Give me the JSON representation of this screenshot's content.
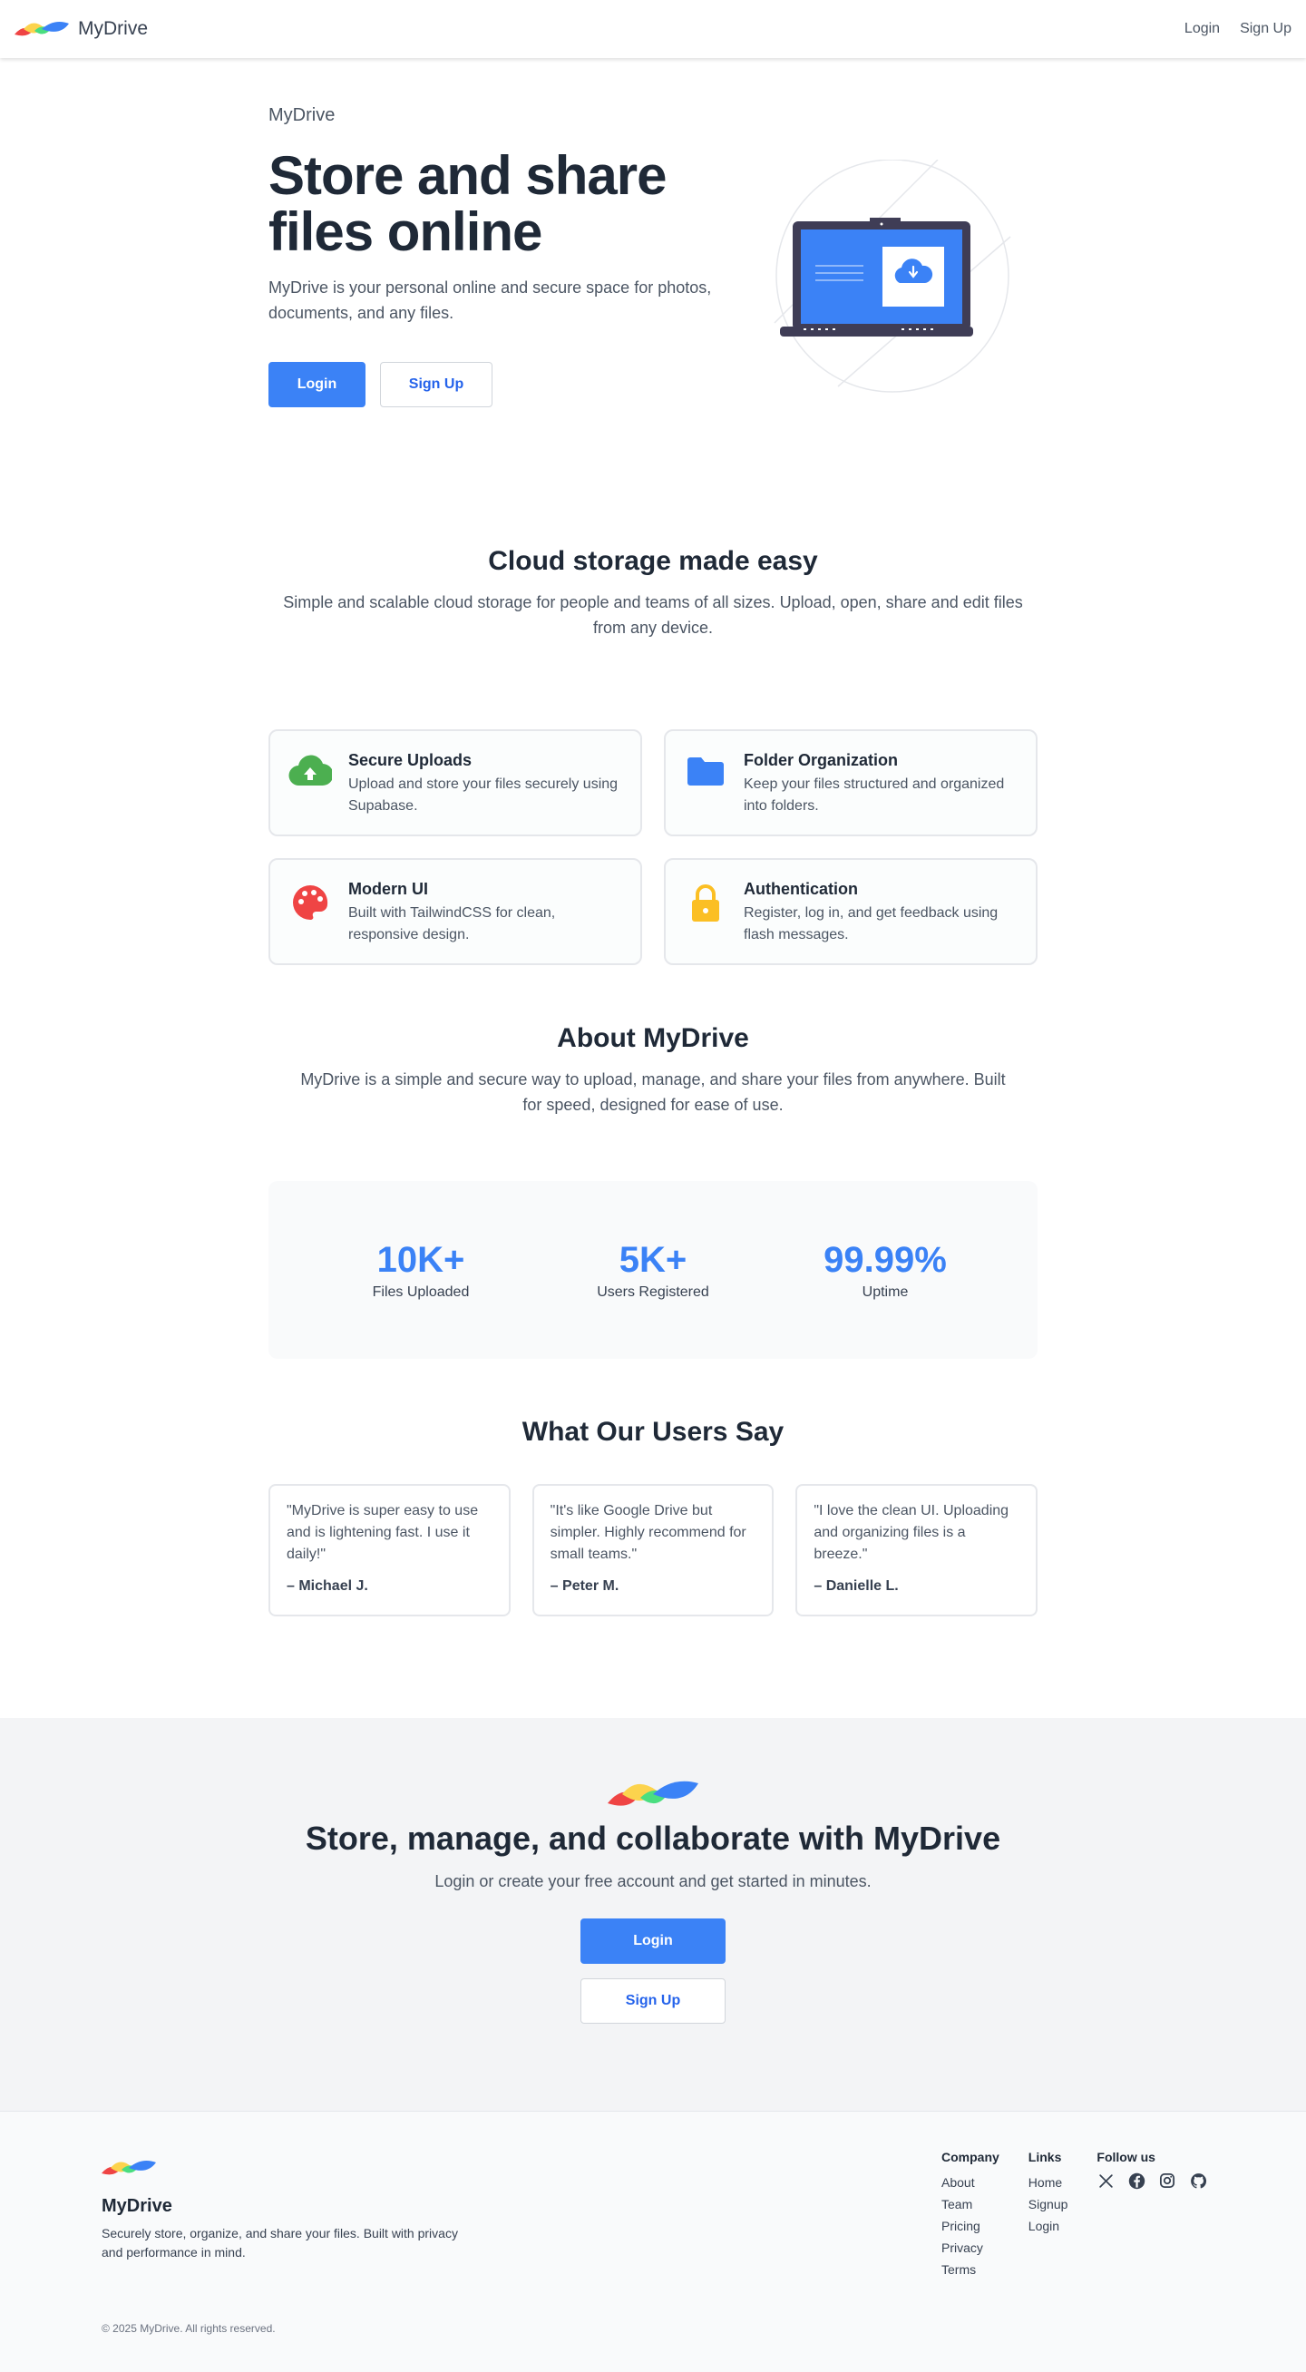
{
  "nav": {
    "brand": "MyDrive",
    "links": [
      "Login",
      "Sign Up"
    ]
  },
  "hero": {
    "eyebrow": "MyDrive",
    "title_line1": "Store and share",
    "title_line2": "files online",
    "description": "MyDrive is your personal online and secure space for photos, documents, and any files.",
    "login_label": "Login",
    "signup_label": "Sign Up"
  },
  "cloud": {
    "title": "Cloud storage made easy",
    "description": "Simple and scalable cloud storage for people and teams of all sizes. Upload, open, share and edit files from any device."
  },
  "features": [
    {
      "icon": "cloud-upload-icon",
      "color": "#4caf50",
      "title": "Secure Uploads",
      "description": "Upload and store your files securely using Supabase."
    },
    {
      "icon": "folder-icon",
      "color": "#3b82f6",
      "title": "Folder Organization",
      "description": "Keep your files structured and organized into folders."
    },
    {
      "icon": "palette-icon",
      "color": "#ef4444",
      "title": "Modern UI",
      "description": "Built with TailwindCSS for clean, responsive design."
    },
    {
      "icon": "lock-icon",
      "color": "#fbbf24",
      "title": "Authentication",
      "description": "Register, log in, and get feedback using flash messages."
    }
  ],
  "about": {
    "title": "About MyDrive",
    "description": "MyDrive is a simple and secure way to upload, manage, and share your files from anywhere. Built for speed, designed for ease of use."
  },
  "stats": [
    {
      "value": "10K+",
      "label": "Files Uploaded"
    },
    {
      "value": "5K+",
      "label": "Users Registered"
    },
    {
      "value": "99.99%",
      "label": "Uptime"
    }
  ],
  "testimonials": {
    "title": "What Our Users Say",
    "items": [
      {
        "quote": "\"MyDrive is super easy to use and is lightening fast. I use it daily!\"",
        "author": "– Michael J."
      },
      {
        "quote": "\"It's like Google Drive but simpler. Highly recommend for small teams.\"",
        "author": "– Peter M."
      },
      {
        "quote": "\"I love the clean UI. Uploading and organizing files is a breeze.\"",
        "author": "– Danielle L."
      }
    ]
  },
  "cta": {
    "title": "Store, manage, and collaborate with MyDrive",
    "description": "Login or create your free account and get started in minutes.",
    "login_label": "Login",
    "signup_label": "Sign Up"
  },
  "footer": {
    "brand": "MyDrive",
    "description": "Securely store, organize, and share your files. Built with privacy and performance in mind.",
    "company": {
      "heading": "Company",
      "links": [
        "About",
        "Team",
        "Pricing",
        "Privacy",
        "Terms"
      ]
    },
    "links": {
      "heading": "Links",
      "links": [
        "Home",
        "Signup",
        "Login"
      ]
    },
    "follow": {
      "heading": "Follow us",
      "icons": [
        "x-icon",
        "facebook-icon",
        "instagram-icon",
        "github-icon"
      ]
    },
    "copyright": "© 2025 MyDrive. All rights reserved."
  },
  "colors": {
    "primary": "#3b82f6",
    "logo_red": "#ef4444",
    "logo_yellow": "#fcd34d",
    "logo_green": "#4ade80",
    "logo_blue": "#3b82f6"
  }
}
